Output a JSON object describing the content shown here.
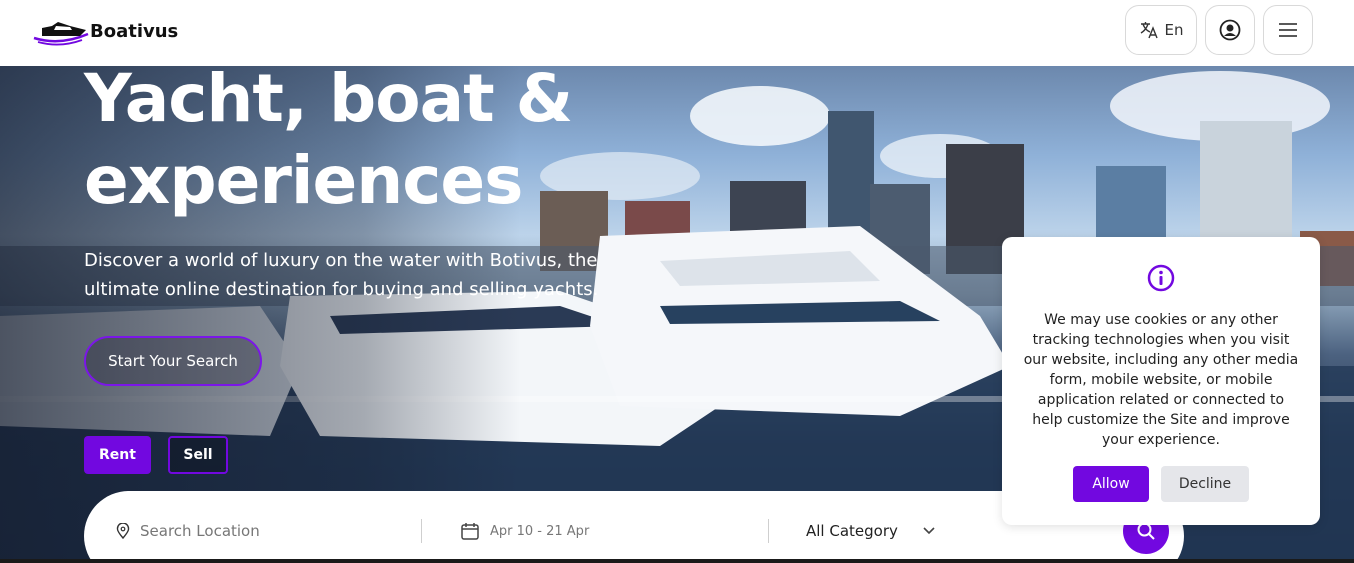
{
  "header": {
    "logo_text": "Boativus",
    "language_label": "En",
    "icons": [
      "translate-icon",
      "user-icon",
      "menu-icon"
    ]
  },
  "hero": {
    "title": "Yacht, boat & experiences",
    "subtitle": "Discover a world of luxury on the water with Botivus, the ultimate online destination for buying and selling yachts.",
    "cta_label": "Start Your Search",
    "rent_label": "Rent",
    "sell_label": "Sell"
  },
  "search": {
    "location_placeholder": "Search Location",
    "date_value": "Apr 10 - 21 Apr",
    "category_value": "All Category"
  },
  "cookie": {
    "message": "We may use cookies or any other tracking technologies when you visit our website, including any other media form, mobile website, or mobile application related or connected to help customize the Site and improve your experience.",
    "allow_label": "Allow",
    "decline_label": "Decline"
  },
  "colors": {
    "accent": "#7208e0",
    "header_bg": "#ffffff",
    "decline_bg": "#e5e6ea"
  }
}
